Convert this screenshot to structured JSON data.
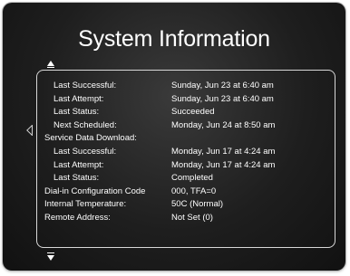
{
  "screen": {
    "title": "System Information"
  },
  "rows": [
    {
      "label": "Last Successful:",
      "value": "Sunday, Jun 23 at 6:40 am",
      "indent": true
    },
    {
      "label": "Last Attempt:",
      "value": "Sunday, Jun 23 at 6:40 am",
      "indent": true
    },
    {
      "label": "Last Status:",
      "value": "Succeeded",
      "indent": true
    },
    {
      "label": "Next Scheduled:",
      "value": "Monday, Jun 24 at 8:50 am",
      "indent": true
    },
    {
      "label": "Service Data Download:",
      "value": "",
      "indent": false
    },
    {
      "label": "Last Successful:",
      "value": "Monday, Jun 17 at 4:24 am",
      "indent": true
    },
    {
      "label": "Last Attempt:",
      "value": "Monday, Jun 17 at 4:24 am",
      "indent": true
    },
    {
      "label": "Last Status:",
      "value": "Completed",
      "indent": true
    },
    {
      "label": "Dial-in Configuration Code",
      "value": "000, TFA=0",
      "indent": false
    },
    {
      "label": "Internal Temperature:",
      "value": "50C (Normal)",
      "indent": false
    },
    {
      "label": "Remote Address:",
      "value": "Not Set (0)",
      "indent": false
    }
  ],
  "icons": {
    "scroll_up": "arrow-up-icon",
    "scroll_down": "arrow-down-icon",
    "back": "arrow-left-icon"
  }
}
